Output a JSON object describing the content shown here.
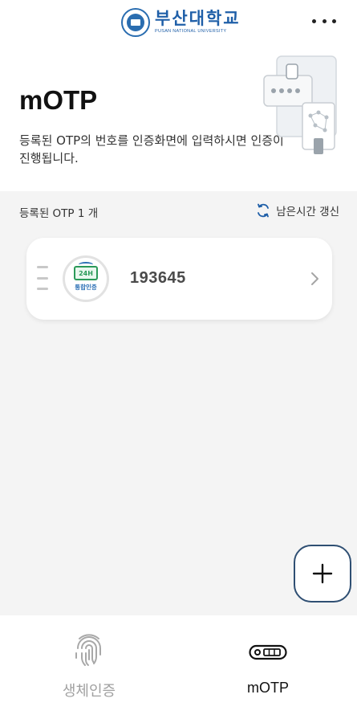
{
  "header": {
    "logo_kr": "부산대학교",
    "logo_en": "PUSAN NATIONAL UNIVERSITY",
    "more_icon": "more-horizontal-icon"
  },
  "hero": {
    "title": "mOTP",
    "description": "등록된 OTP의 번호를 인증화면에 입력하시면 인증이 진행됩니다."
  },
  "list": {
    "count_label": "등록된 OTP 1 개",
    "refresh_label": "남은시간 갱신",
    "items": [
      {
        "logo_label": "통합인증",
        "code": "193645"
      }
    ]
  },
  "fab": {
    "icon": "plus-icon"
  },
  "bottom_nav": {
    "items": [
      {
        "label": "생체인증",
        "icon": "fingerprint-icon",
        "active": false
      },
      {
        "label": "mOTP",
        "icon": "otp-token-icon",
        "active": true
      }
    ]
  },
  "colors": {
    "brand_blue": "#1f5fa8",
    "background_gray": "#f4f4f4",
    "fab_border": "#2f4f73",
    "otp_logo_green": "#2b9a59"
  }
}
